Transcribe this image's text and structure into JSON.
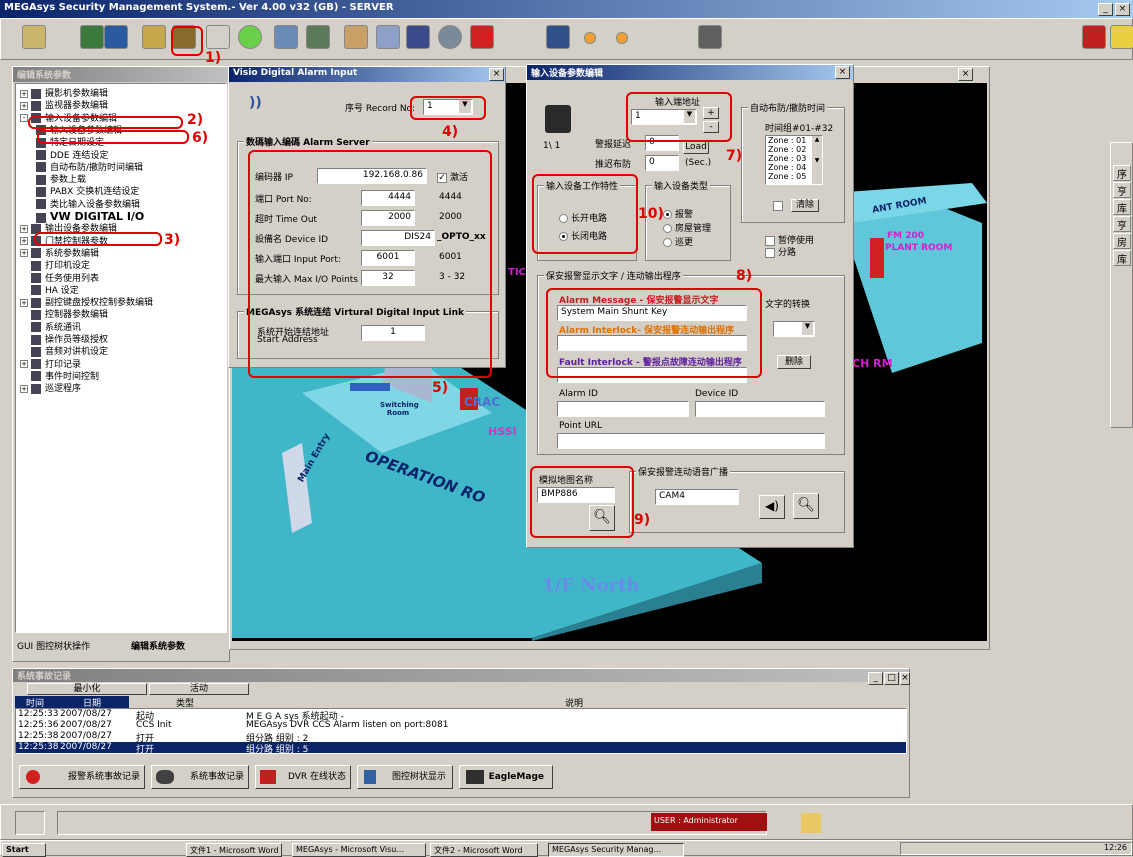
{
  "app": {
    "title": "MEGAsys Security Management System.- Ver 4.00 v32 (GB) - SERVER",
    "win_min": "_",
    "win_max": "×"
  },
  "annotations": {
    "n1": "1)",
    "n2": "2)",
    "n3": "3)",
    "n4": "4)",
    "n5": "5)",
    "n6": "6)",
    "n7": "7)",
    "n8": "8)",
    "n9": "9)",
    "n10": "10)"
  },
  "left_panel": {
    "title": "编辑系统参数",
    "tree": [
      {
        "pm": "+",
        "label": "摄影机参数编辑",
        "indent": 0
      },
      {
        "pm": "+",
        "label": "监视器参数编辑",
        "indent": 0
      },
      {
        "pm": "-",
        "label": "输入设备参数编辑",
        "indent": 0
      },
      {
        "pm": "",
        "label": "输入设备参数编辑",
        "indent": 1
      },
      {
        "pm": "",
        "label": "特定日期设定",
        "indent": 1
      },
      {
        "pm": "",
        "label": "DDE 连结设定",
        "indent": 1
      },
      {
        "pm": "",
        "label": "自动布防/撤防时间编辑",
        "indent": 1
      },
      {
        "pm": "",
        "label": "参数上载",
        "indent": 1
      },
      {
        "pm": "",
        "label": "PABX 交换机连结设定",
        "indent": 1
      },
      {
        "pm": "",
        "label": "类比输入设备参数编辑",
        "indent": 1
      },
      {
        "pm": "",
        "label": "VW DIGITAL I/O",
        "indent": 1
      },
      {
        "pm": "+",
        "label": "输出设备参数编辑",
        "indent": 0
      },
      {
        "pm": "+",
        "label": "门禁控制器参数",
        "indent": 0
      },
      {
        "pm": "+",
        "label": "系统参数编辑",
        "indent": 0
      },
      {
        "pm": "",
        "label": "打印机设定",
        "indent": 0
      },
      {
        "pm": "",
        "label": "任务使用列表",
        "indent": 0
      },
      {
        "pm": "",
        "label": "HA 设定",
        "indent": 0
      },
      {
        "pm": "+",
        "label": "副控键盘授权控制参数编辑",
        "indent": 0
      },
      {
        "pm": "",
        "label": "控制器参数编辑",
        "indent": 0
      },
      {
        "pm": "",
        "label": "系统通讯",
        "indent": 0
      },
      {
        "pm": "",
        "label": "操作员等级授权",
        "indent": 0
      },
      {
        "pm": "",
        "label": "音频对讲机设定",
        "indent": 0
      },
      {
        "pm": "+",
        "label": "打印记录",
        "indent": 0
      },
      {
        "pm": "",
        "label": "事件时间控制",
        "indent": 0
      },
      {
        "pm": "+",
        "label": "巡逻程序",
        "indent": 0
      }
    ],
    "bottom_tabs": [
      "GUI 图控树状操作",
      "编辑系统参数"
    ]
  },
  "visio_dialog": {
    "title": "Visio Digital Alarm Input",
    "record_label": "序号 Record No:",
    "record_value": "1",
    "group1_title": "数碼输入编碼 Alarm Server",
    "ip_label": "编码器 IP",
    "ip_value": "192.168.0.86",
    "activate_label": "激活",
    "port_label": "端口 Port No:",
    "port_value": "4444",
    "port_default": "4444",
    "timeout_label": "超时 Time Out",
    "timeout_value": "2000",
    "timeout_default": "2000",
    "device_label": "設備名 Device ID",
    "device_value": "DIS24",
    "device_suffix": "_OPTO_xx",
    "input_port_label": "输入端口 Input Port:",
    "input_port_value": "6001",
    "input_port_default": "6001",
    "max_label": "最大输入 Max I/O Points",
    "max_value": "32",
    "max_range": "3 - 32",
    "group2_title": "MEGAsys 系统连结  Virtural Digital Input Link",
    "start_label": "系统开始连结地址",
    "start_label2": "Start Address",
    "start_value": "1"
  },
  "input_dialog": {
    "title": "输入设备参数编辑",
    "counter": "1\\ 1",
    "addr_label": "输入端地址",
    "addr_value": "1",
    "plus": "+",
    "minus": "-",
    "alarm_delay_label": "警报延迟",
    "alarm_delay_value": "0",
    "load_btn": "Load",
    "arm_delay_label": "推迟布防",
    "arm_delay_value": "0",
    "sec": "(Sec.)",
    "auto_title": "自动布防/撤防时间",
    "time_group": "时间组#01-#32",
    "zones": [
      "Zone : 01",
      "Zone : 02",
      "Zone : 03",
      "Zone : 04",
      "Zone : 05"
    ],
    "clear_btn": "清除",
    "char_title": "输入设备工作特性",
    "normally_open": "长开电路",
    "normally_closed": "长闭电路",
    "type_title": "输入设备类型",
    "type_alarm": "报警",
    "type_room": "房屋管理",
    "type_patrol": "巡更",
    "pause": "暂停使用",
    "bypass": "分路",
    "msg_group_title": "保安报警显示文字 / 连动输出程序",
    "alarm_msg_label": "Alarm Message - 保安报警显示文字",
    "alarm_msg_value": "System Main Shunt Key",
    "interlock_label": "Alarm Interlock- 保安报警连动输出程序",
    "fault_label": "Fault Interlock - 警报点故障连动输出程序",
    "convert_title": "文字的转换",
    "delete_btn": "删除",
    "alarm_id_label": "Alarm ID",
    "device_id_label": "Device ID",
    "point_url_label": "Point URL",
    "map_label": "模拟地图名称",
    "map_value": "BMP886",
    "voice_title": "保安报警连动语音广播",
    "voice_value": "CAM4"
  },
  "scene": {
    "labels": [
      "OPERATION RO",
      "1/F North",
      "Main Entry",
      "Switching Room",
      "CRAC",
      "HSSI",
      "CH RM",
      "FM 200",
      "PLANT ROOM",
      "ANT ROOM",
      "TIC"
    ]
  },
  "events": {
    "title": "系统事故记录",
    "tab_min": "最小化",
    "tab_active": "活动",
    "col_time": "时间",
    "col_date": "日期",
    "col_type": "类型",
    "col_desc": "说明",
    "rows": [
      {
        "time": "12:25:33",
        "date": "2007/08/27",
        "type": "起动",
        "desc": "M E G A sys 系统起动 -"
      },
      {
        "time": "12:25:36",
        "date": "2007/08/27",
        "type": "CCS Init",
        "desc": "MEGAsys DVR CCS Alarm listen on port:8081"
      },
      {
        "time": "12:25:38",
        "date": "2007/08/27",
        "type": "打开",
        "desc": "组分路  组别 : 2"
      },
      {
        "time": "12:25:38",
        "date": "2007/08/27",
        "type": "打开",
        "desc": "组分路  组别 : 5"
      }
    ],
    "bottom_tabs": [
      "报警系统事故记录",
      "系统事故记录",
      "DVR 在线状态",
      "图控树状显示",
      "EagleMage"
    ]
  },
  "status": {
    "user": "USER : Administrator"
  },
  "taskbar": {
    "start": "Start",
    "items": [
      "文件1 - Microsoft Word",
      "MEGAsys - Microsoft Visu...",
      "文件2 - Microsoft Word",
      "MEGAsys Security Manag..."
    ],
    "clock": "12:26"
  },
  "right_toolbar": [
    "序",
    "亨",
    "库",
    "亨",
    "房",
    "库"
  ],
  "colors": {
    "title_blue": "#0a246a",
    "annotation_red": "#e00000",
    "scene_floor": "#3fb7c9"
  }
}
